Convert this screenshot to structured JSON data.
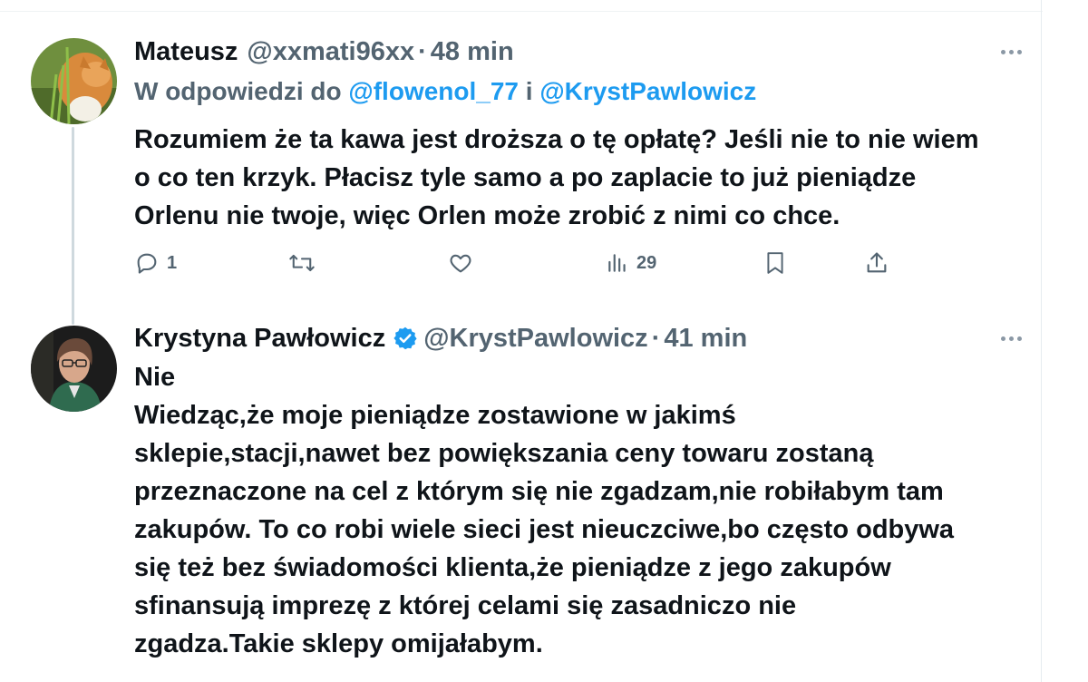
{
  "tweets": [
    {
      "display_name": "Mateusz",
      "handle": "@xxmati96xx",
      "separator": "·",
      "time": "48 min",
      "reply_to": {
        "prefix": "W odpowiedzi do",
        "first": "@flowenol_77",
        "conjunction": "i",
        "second": "@KrystPawlowicz"
      },
      "text_lines": [
        "Rozumiem że ta kawa jest droższa o tę opłatę? Jeśli nie to nie wiem",
        "o co ten krzyk. Płacisz tyle samo a po zaplacie to już pieniądze",
        "Orlenu nie twoje, więc Orlen może zrobić z nimi co chce."
      ],
      "actions": {
        "reply_count": "1",
        "retweet_count": "",
        "like_count": "",
        "views_count": "29"
      }
    },
    {
      "display_name": "Krystyna Pawłowicz",
      "verified": true,
      "handle": "@KrystPawlowicz",
      "separator": "·",
      "time": "41 min",
      "text_lines": [
        "Nie",
        "Wiedząc,że moje pieniądze zostawione w jakimś",
        "sklepie,stacji,nawet bez powiększania ceny towaru zostaną",
        "przeznaczone na cel z którym się nie zgadzam,nie robiłabym tam",
        "zakupów. To co robi wiele sieci jest nieuczciwe,bo często odbywa",
        "się też bez świadomości klienta,że pieniądze z jego zakupów",
        "sfinansują imprezę z której celami się zasadniczo nie",
        "zgadza.Takie sklepy omijałabym."
      ]
    }
  ],
  "colors": {
    "text_primary": "#0f1419",
    "text_secondary": "#536471",
    "link": "#1d9bf0",
    "verified_badge": "#1d9bf0",
    "thread_line": "#cfd9de"
  },
  "icons": [
    "reply-icon",
    "retweet-icon",
    "like-icon",
    "views-icon",
    "bookmark-icon",
    "share-icon",
    "more-icon",
    "verified-badge-icon"
  ]
}
